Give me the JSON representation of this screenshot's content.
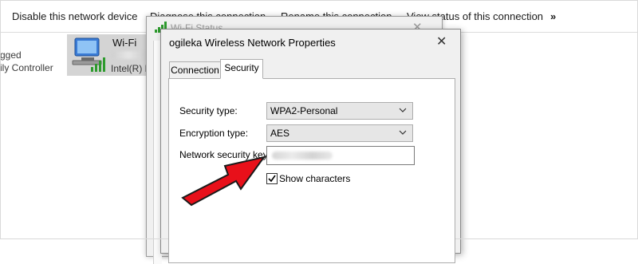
{
  "command_bar": {
    "disable": "Disable this network device",
    "diagnose": "Diagnose this connection",
    "rename": "Rename this connection",
    "view_status": "View status of this connection",
    "more": "»"
  },
  "left_panel": {
    "status_partial": "gged",
    "controller_partial": "ily Controller"
  },
  "wifi_item": {
    "name": "Wi-Fi",
    "adapter_partial": "Intel(R) D"
  },
  "status_window": {
    "title": "Wi-Fi Status"
  },
  "dialog": {
    "title": "ogileka Wireless Network Properties",
    "close_glyph": "✕",
    "tabs": [
      "Connection",
      "Security"
    ],
    "active_tab": "Security",
    "security_type_label": "Security type:",
    "security_type_value": "WPA2-Personal",
    "encryption_type_label": "Encryption type:",
    "encryption_type_value": "AES",
    "network_key_label": "Network security key",
    "show_characters_label": "Show characters",
    "show_characters_checked": true
  },
  "colors": {
    "arrow_fill": "#e8101a",
    "arrow_stroke": "#1a1a1a",
    "signal_green": "#2e9b2e"
  }
}
